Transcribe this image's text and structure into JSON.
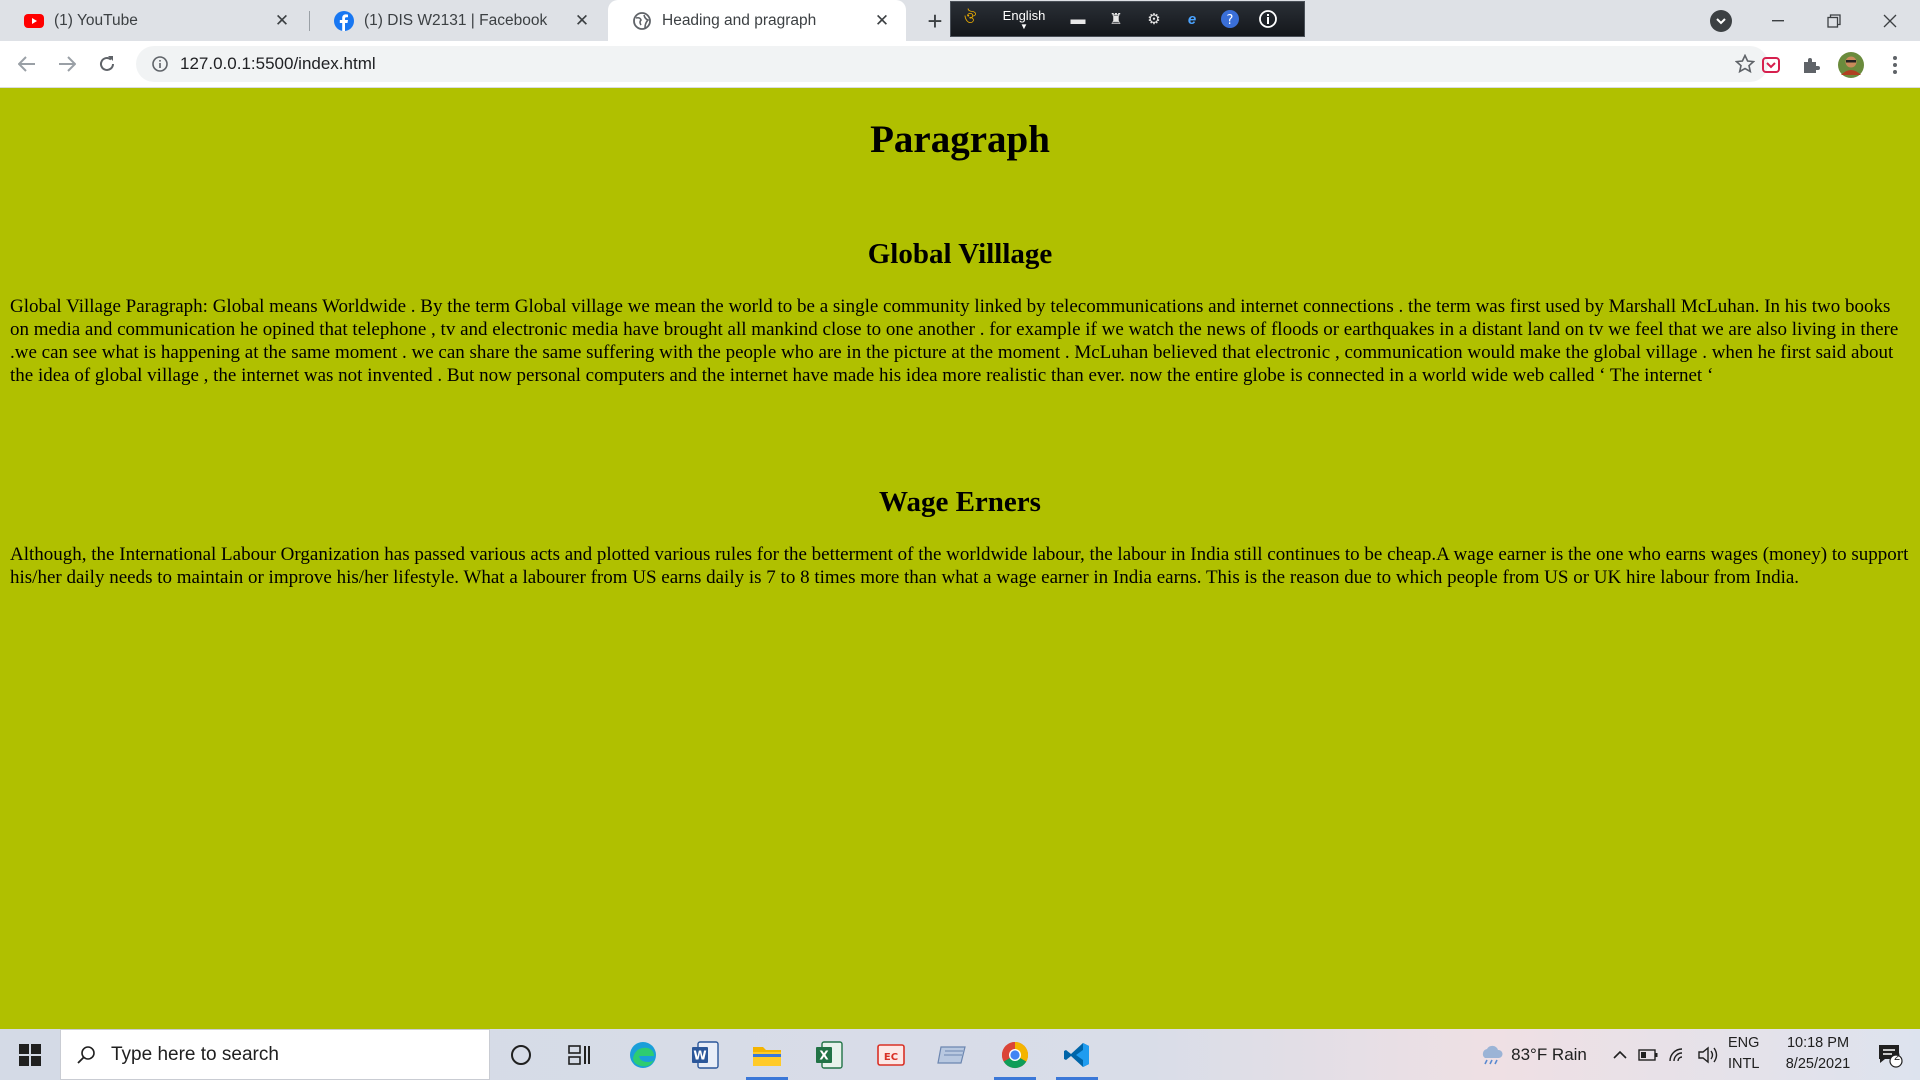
{
  "browser": {
    "tabs": [
      {
        "title": "(1) YouTube",
        "icon": "youtube-icon",
        "active": false
      },
      {
        "title": "(1) DIS W2131 | Facebook",
        "icon": "facebook-icon",
        "active": false
      },
      {
        "title": "Heading and pragraph",
        "icon": "globe-icon",
        "active": true
      }
    ],
    "new_tab_label": "+",
    "language_bar": {
      "language": "English"
    },
    "address": "127.0.0.1:5500/index.html"
  },
  "page": {
    "title": "Paragraph",
    "sections": [
      {
        "heading": "Global Villlage",
        "text": "Global Village Paragraph: Global means Worldwide . By the term Global village we mean the world to be a single community linked by telecommunications and internet connections . the term was first used by Marshall McLuhan. In his two books on media and communication he opined that telephone , tv and electronic media have brought all mankind close to one another . for example if we watch the news of floods or earthquakes in a distant land on tv we feel that we are also living in there .we can see what is happening at the same moment . we can share the same suffering with the people who are in the picture at the moment . McLuhan believed that electronic , communication would make the global village . when he first said about the idea of global village , the internet was not invented . But now personal computers and the internet have made his idea more realistic than ever. now the entire globe is connected in a world wide web called ‘ The internet ‘"
      },
      {
        "heading": "Wage Erners",
        "text": "Although, the International Labour Organization has passed various acts and plotted various rules for the betterment of the worldwide labour, the labour in India still continues to be cheap.A wage earner is the one who earns wages (money) to support his/her daily needs to maintain or improve his/her lifestyle. What a labourer from US earns daily is 7 to 8 times more than what a wage earner in India earns. This is the reason due to which people from US or UK hire labour from India."
      }
    ],
    "background_color": "#b0c000"
  },
  "taskbar": {
    "search_placeholder": "Type here to search",
    "weather": "83°F  Rain",
    "language": "ENG",
    "keyboard": "INTL",
    "time": "10:18 PM",
    "date": "8/25/2021",
    "notification_count": "2"
  }
}
